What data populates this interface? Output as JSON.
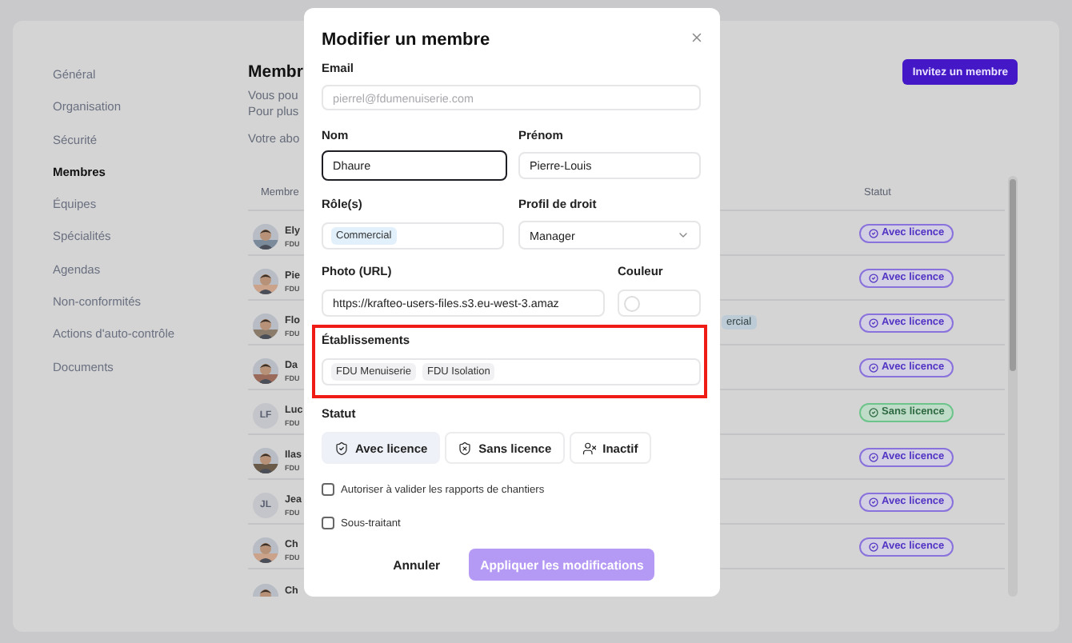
{
  "sidebar": {
    "items": [
      {
        "label": "Général",
        "selected": false
      },
      {
        "label": "Organisation",
        "selected": false
      },
      {
        "label": "Sécurité",
        "selected": false
      },
      {
        "label": "Membres",
        "selected": true
      },
      {
        "label": "Équipes",
        "selected": false
      },
      {
        "label": "Spécialités",
        "selected": false
      },
      {
        "label": "Agendas",
        "selected": false
      },
      {
        "label": "Non-conformités",
        "selected": false
      },
      {
        "label": "Actions d'auto-contrôle",
        "selected": false
      },
      {
        "label": "Documents",
        "selected": false
      }
    ]
  },
  "header": {
    "title": "Membr",
    "lines": [
      "Vous pou",
      "Pour plus"
    ],
    "subscription": "Votre abo",
    "invite_button": "Invitez un membre"
  },
  "table": {
    "columns": [
      "Membre",
      "Statut"
    ],
    "rows": [
      {
        "name": "Ely",
        "company": "FDU",
        "status": {
          "kind": "licensed",
          "label": "Avec licence"
        }
      },
      {
        "name": "Pie",
        "company": "FDU",
        "status": {
          "kind": "licensed",
          "label": "Avec licence"
        }
      },
      {
        "name": "Flo",
        "company": "FDU",
        "role_tag": "ercial",
        "status": {
          "kind": "licensed",
          "label": "Avec licence"
        }
      },
      {
        "name": "Da",
        "company": "FDU",
        "status": {
          "kind": "licensed",
          "label": "Avec licence"
        }
      },
      {
        "kind": "initials",
        "initials": "LF",
        "name": "Luc",
        "company": "FDU",
        "status": {
          "kind": "unlicensed",
          "label": "Sans licence"
        }
      },
      {
        "name": "Ilas",
        "company": "FDU",
        "status": {
          "kind": "licensed",
          "label": "Avec licence"
        }
      },
      {
        "kind": "initials",
        "initials": "JL",
        "name": "Jea",
        "company": "FDU",
        "status": {
          "kind": "licensed",
          "label": "Avec licence"
        }
      },
      {
        "name": "Ch",
        "company": "FDU",
        "status": {
          "kind": "licensed",
          "label": "Avec licence"
        }
      },
      {
        "name": "Ch"
      }
    ]
  },
  "modal": {
    "title": "Modifier un membre",
    "email": {
      "label": "Email",
      "value": "pierrel@fdumenuiserie.com",
      "disabled": true
    },
    "last_name": {
      "label": "Nom",
      "value": "Dhaure",
      "focused": true
    },
    "first_name": {
      "label": "Prénom",
      "value": "Pierre-Louis",
      "focused": false
    },
    "roles": {
      "label": "Rôle(s)",
      "tags": [
        "Commercial"
      ]
    },
    "profile": {
      "label": "Profil de droit",
      "value": "Manager"
    },
    "photo": {
      "label": "Photo (URL)",
      "value": "https://krafteo-users-files.s3.eu-west-3.amaz"
    },
    "color": {
      "label": "Couleur"
    },
    "establishments": {
      "label": "Établissements",
      "tags": [
        "FDU Menuiserie",
        "FDU Isolation"
      ],
      "highlighted": true
    },
    "status": {
      "label": "Statut",
      "options": [
        {
          "kind": "licensed",
          "label": "Avec licence",
          "selected": true
        },
        {
          "kind": "unlicensed",
          "label": "Sans licence",
          "selected": false
        },
        {
          "kind": "inactive",
          "label": "Inactif",
          "selected": false
        }
      ]
    },
    "checkboxes": [
      {
        "label": "Autoriser à valider les rapports de chantiers",
        "checked": false
      },
      {
        "label": "Sous-traitant",
        "checked": false
      }
    ],
    "cancel": "Annuler",
    "submit": {
      "label": "Appliquer les modifications",
      "disabled": true
    }
  }
}
